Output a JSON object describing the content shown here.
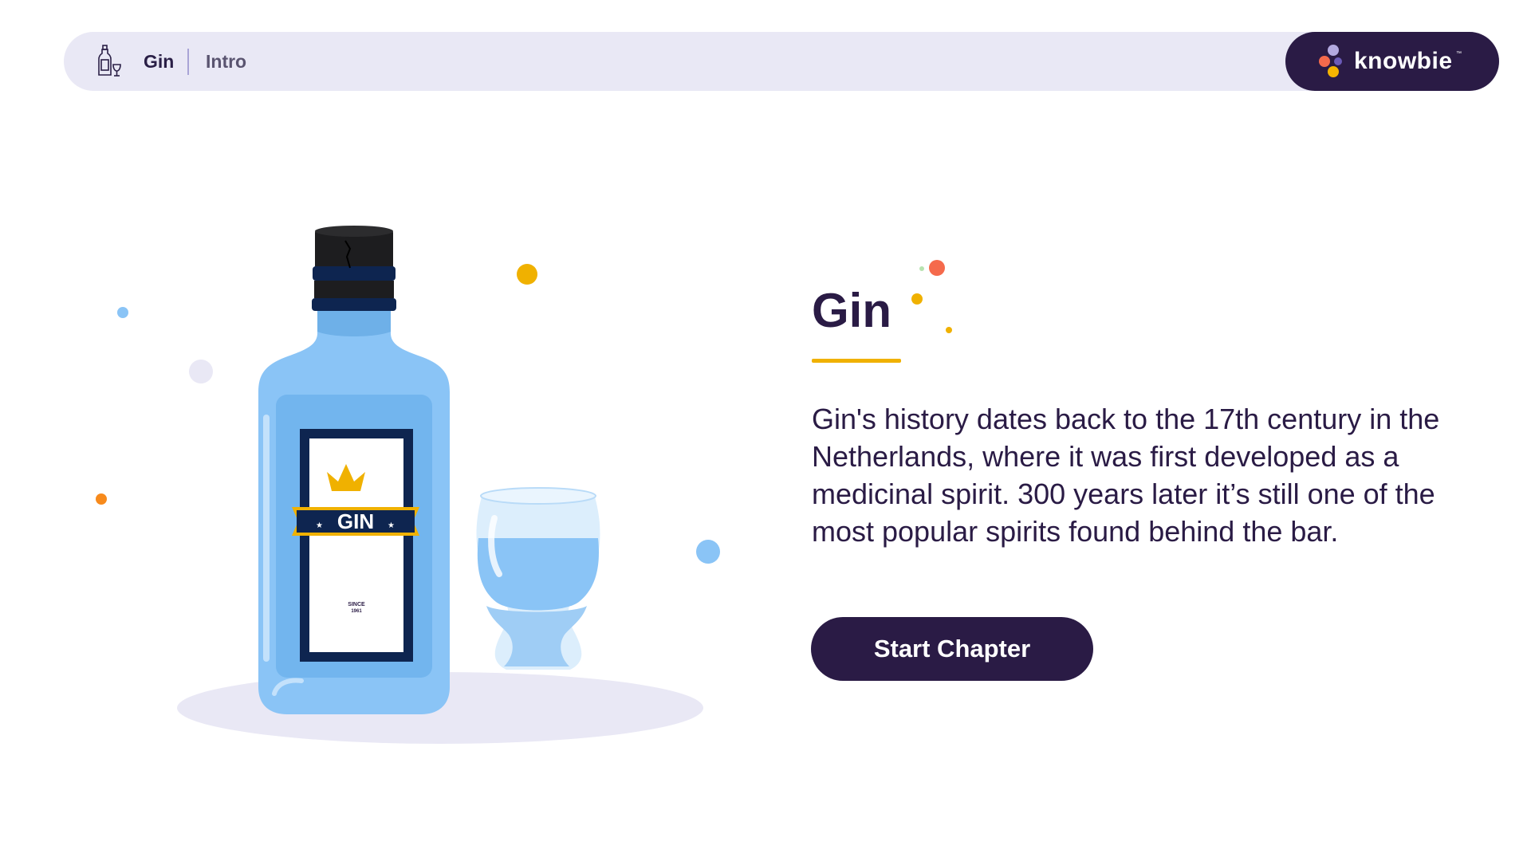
{
  "breadcrumb": {
    "icon": "bottle-glass-icon",
    "course": "Gin",
    "section": "Intro"
  },
  "brand": {
    "name": "knowbie",
    "trademark": "™"
  },
  "illustration": {
    "label_text": "GIN",
    "label_since": "SINCE",
    "label_year": "1961"
  },
  "content": {
    "title": "Gin",
    "description": "Gin's history dates back to the 17th century in the Netherlands, where it was first developed as a medicinal spirit. 300 years later it’s still one of the most popular spirits found behind the bar.",
    "start_button": "Start Chapter"
  },
  "colors": {
    "dark_purple": "#2a1b45",
    "bar_background": "#e9e8f5",
    "accent_yellow": "#f0b100",
    "bottle_blue": "#8ac4f6"
  }
}
